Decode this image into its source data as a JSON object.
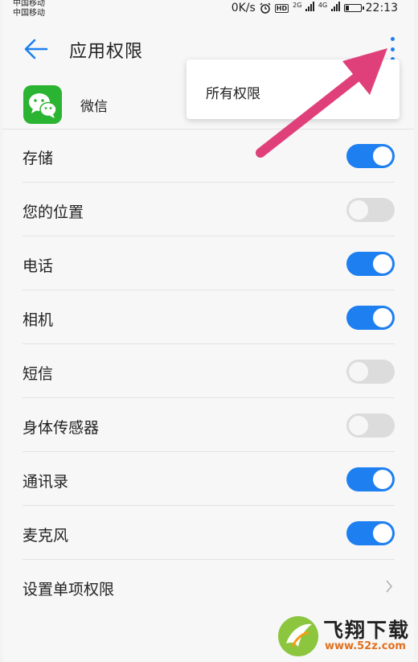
{
  "status_bar": {
    "carrier_1": "中国移动",
    "carrier_2": "中国移动",
    "speed": "0K/s",
    "hd": "HD",
    "net_1": "2G",
    "net_2": "4G",
    "battery_level": 0.25,
    "time": "22:13"
  },
  "header": {
    "title": "应用权限",
    "back_icon": "back-arrow-icon",
    "more_icon": "more-vertical-icon"
  },
  "app": {
    "name": "微信",
    "icon": "wechat-icon"
  },
  "permissions": [
    {
      "label": "存储",
      "enabled": true
    },
    {
      "label": "您的位置",
      "enabled": false
    },
    {
      "label": "电话",
      "enabled": true
    },
    {
      "label": "相机",
      "enabled": true
    },
    {
      "label": "短信",
      "enabled": false
    },
    {
      "label": "身体传感器",
      "enabled": false
    },
    {
      "label": "通讯录",
      "enabled": true
    },
    {
      "label": "麦克风",
      "enabled": true
    }
  ],
  "single_permission": {
    "label": "设置单项权限",
    "icon": "chevron-right-icon"
  },
  "popup_menu": {
    "items": [
      "所有权限"
    ]
  },
  "watermark": {
    "title": "飞翔下载",
    "url": "www.52z.com"
  },
  "colors": {
    "accent": "#1d7ff0",
    "toggle_off": "#dcdcdc",
    "arrow": "#e0407a",
    "wechat_green": "#2bb431"
  }
}
